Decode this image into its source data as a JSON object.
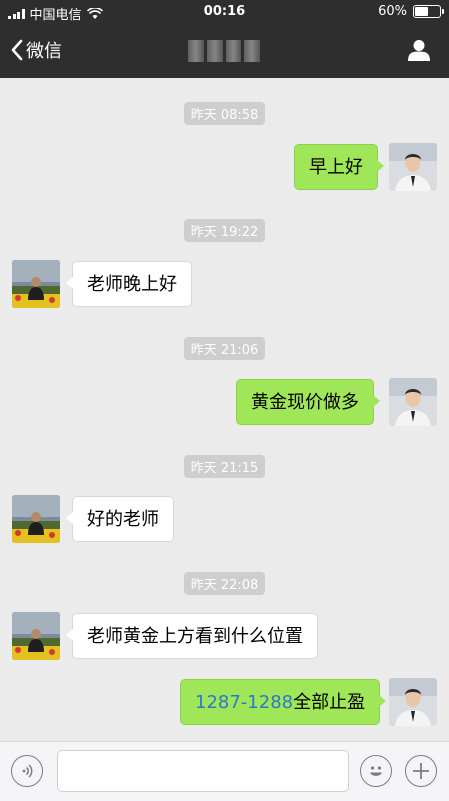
{
  "status": {
    "carrier": "中国电信",
    "time": "00:16",
    "battery": "60%",
    "battery_level": 0.6
  },
  "nav": {
    "back_label": "微信"
  },
  "messages": [
    {
      "time": "昨天 08:58",
      "side": "right",
      "text": "早上好"
    },
    {
      "time": "昨天 19:22",
      "side": "left",
      "text": "老师晚上好"
    },
    {
      "time": "昨天 21:06",
      "side": "right",
      "text": "黄金现价做多"
    },
    {
      "time": "昨天 21:15",
      "side": "left",
      "text": "好的老师"
    },
    {
      "time": "昨天 22:08",
      "side": "left",
      "text": "老师黄金上方看到什么位置"
    },
    {
      "side": "right",
      "link": "1287-1288",
      "text": "全部止盈"
    }
  ],
  "icons": {
    "voice": "voice-icon",
    "emoji": "emoji-icon",
    "plus": "plus-icon",
    "profile": "profile-icon",
    "back": "chevron-left-icon"
  }
}
